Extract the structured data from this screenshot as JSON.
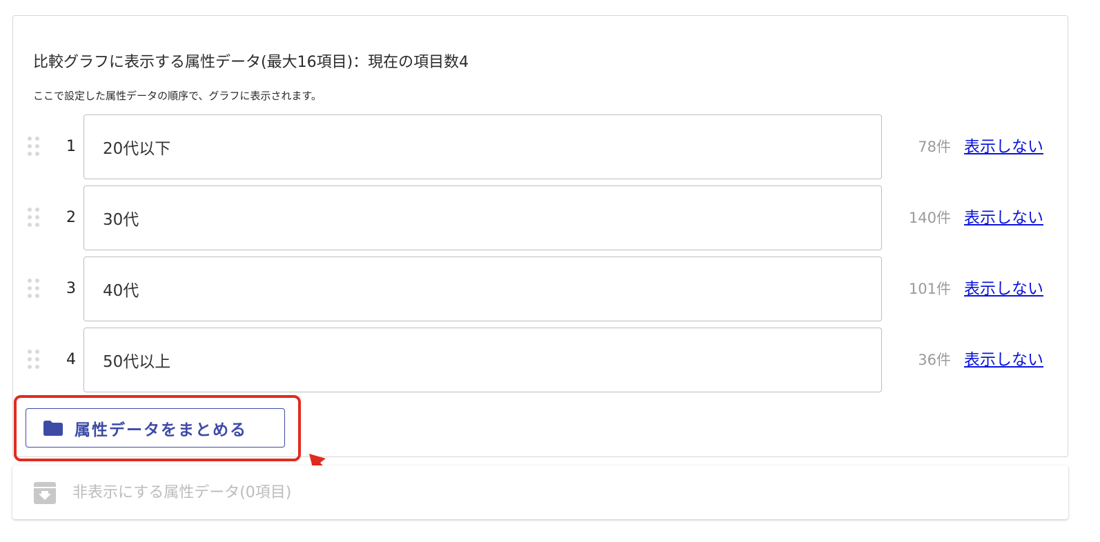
{
  "header": {
    "title": "比較グラフに表示する属性データ(最大16項目)：現在の項目数4",
    "subtitle": "ここで設定した属性データの順序で、グラフに表示されます。"
  },
  "rows": [
    {
      "index": "1",
      "value": "20代以下",
      "count": "78件",
      "hide_label": "表示しない"
    },
    {
      "index": "2",
      "value": "30代",
      "count": "140件",
      "hide_label": "表示しない"
    },
    {
      "index": "3",
      "value": "40代",
      "count": "101件",
      "hide_label": "表示しない"
    },
    {
      "index": "4",
      "value": "50代以上",
      "count": "36件",
      "hide_label": "表示しない"
    }
  ],
  "group_button": {
    "label": "属性データをまとめる",
    "icon": "folder-icon"
  },
  "hidden_section": {
    "label": "非表示にする属性データ(0項目)",
    "icon": "archive-icon"
  },
  "colors": {
    "accent": "#3d4aa6",
    "link": "#0a14d9",
    "highlight": "#e02b20",
    "muted_text": "#9a9a9a"
  }
}
